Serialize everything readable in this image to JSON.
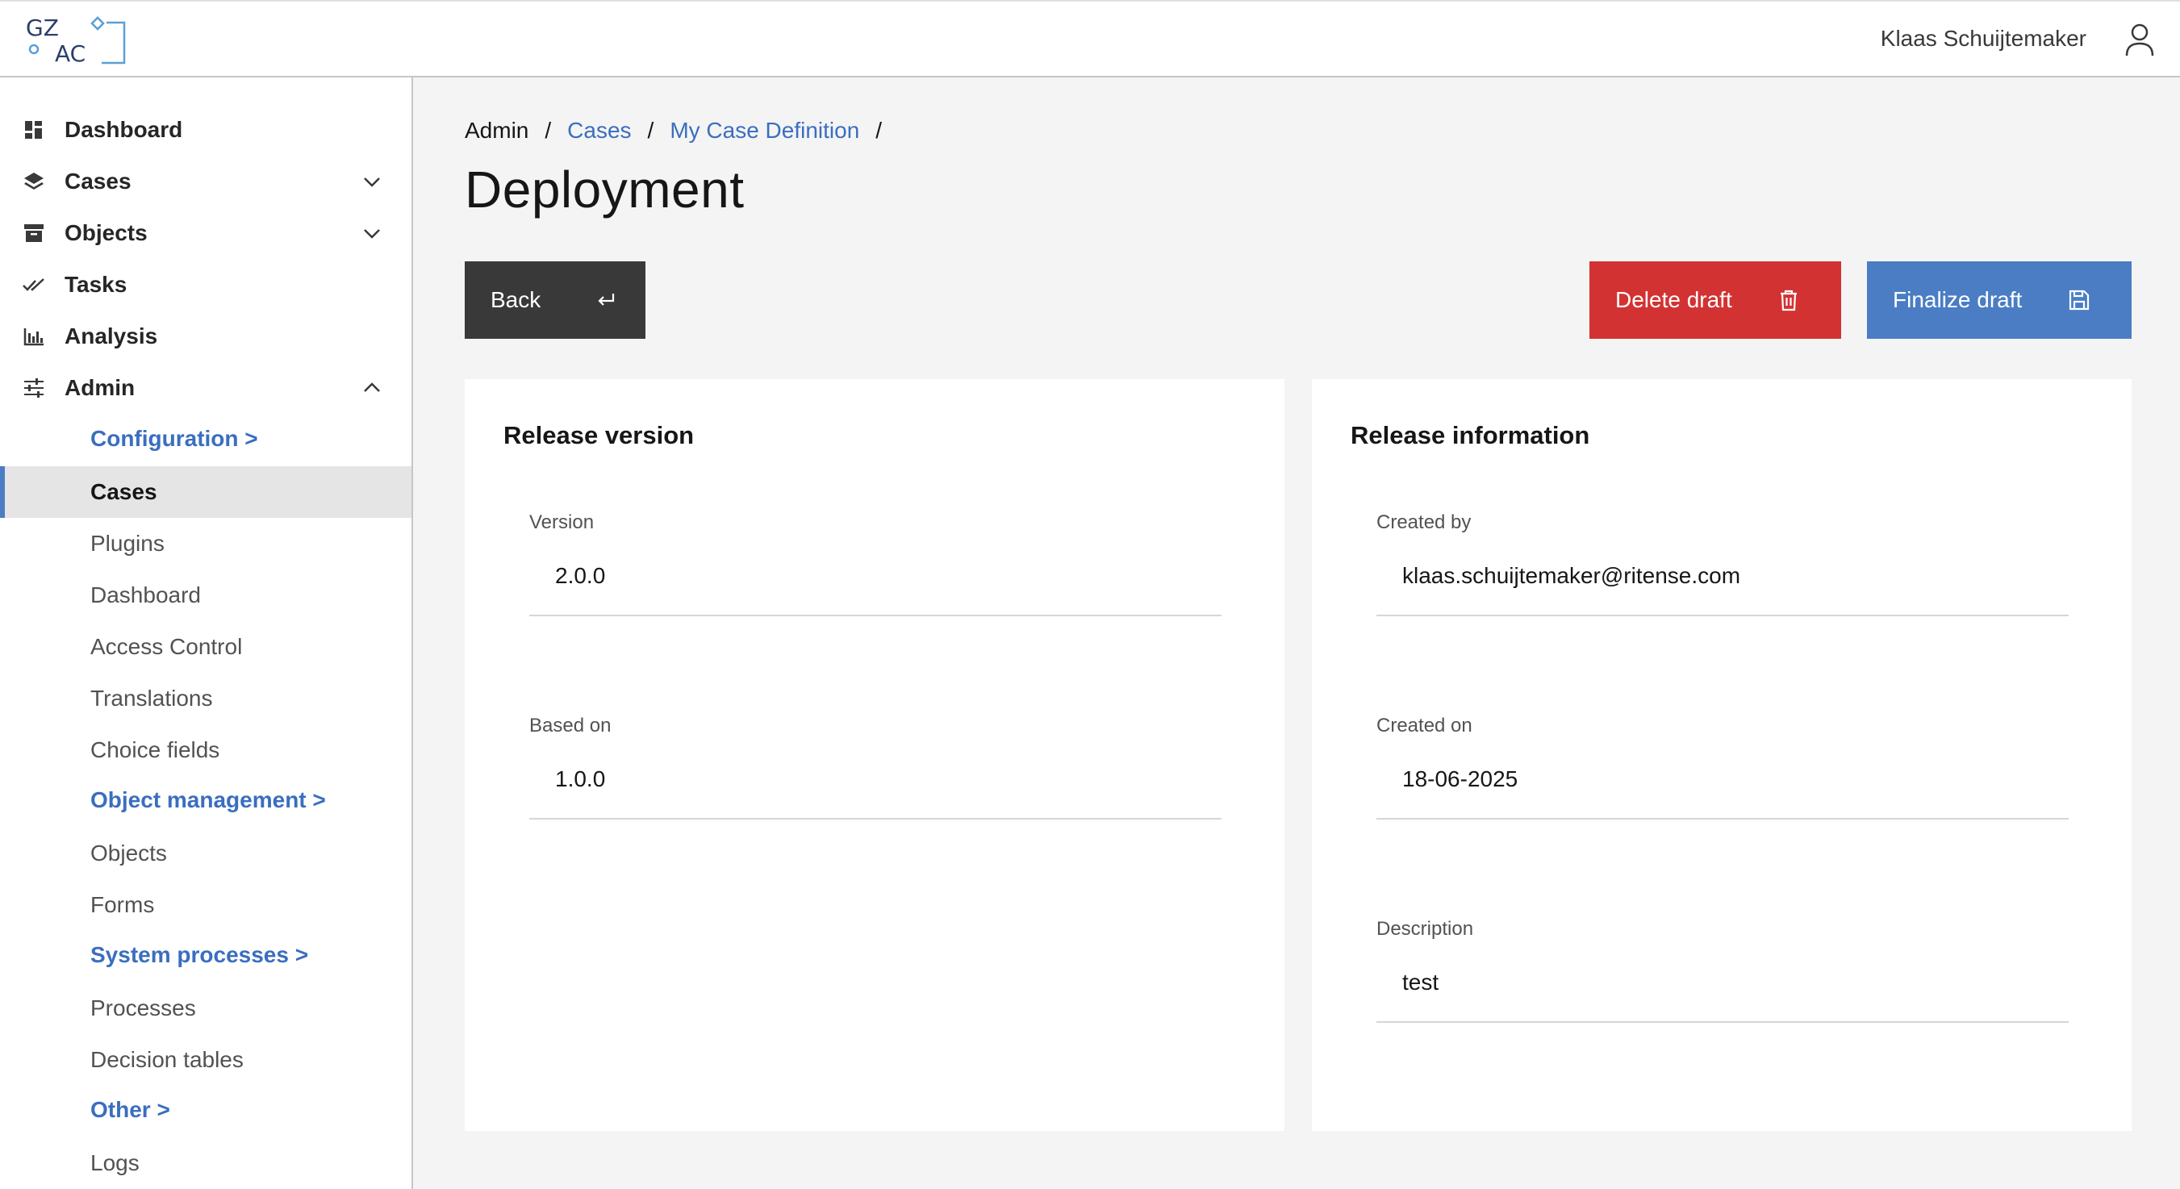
{
  "header": {
    "logo_line1": "GZ",
    "logo_line2": "AC",
    "user_name": "Klaas Schuijtemaker",
    "user_icon": "user-icon"
  },
  "sidebar": {
    "main_items": [
      {
        "label": "Dashboard",
        "icon": "grid-icon"
      },
      {
        "label": "Cases",
        "icon": "layers-icon",
        "chevron": "down"
      },
      {
        "label": "Objects",
        "icon": "archive-icon",
        "chevron": "down"
      },
      {
        "label": "Tasks",
        "icon": "checkmark-icon"
      },
      {
        "label": "Analysis",
        "icon": "bar-chart-icon"
      },
      {
        "label": "Admin",
        "icon": "sliders-icon",
        "chevron": "up"
      }
    ],
    "sub_items": [
      {
        "label": "Configuration >",
        "type": "group"
      },
      {
        "label": "Cases",
        "type": "item",
        "active": true
      },
      {
        "label": "Plugins",
        "type": "item"
      },
      {
        "label": "Dashboard",
        "type": "item"
      },
      {
        "label": "Access Control",
        "type": "item"
      },
      {
        "label": "Translations",
        "type": "item"
      },
      {
        "label": "Choice fields",
        "type": "item"
      },
      {
        "label": "Object management >",
        "type": "group"
      },
      {
        "label": "Objects",
        "type": "item"
      },
      {
        "label": "Forms",
        "type": "item"
      },
      {
        "label": "System processes >",
        "type": "group"
      },
      {
        "label": "Processes",
        "type": "item"
      },
      {
        "label": "Decision tables",
        "type": "item"
      },
      {
        "label": "Other >",
        "type": "group"
      },
      {
        "label": "Logs",
        "type": "item"
      }
    ]
  },
  "breadcrumb": [
    "Admin",
    "Cases",
    "My Case Definition"
  ],
  "breadcrumb_separator": "/",
  "page_title": "Deployment",
  "buttons": {
    "back": "Back",
    "delete": "Delete draft",
    "finalize": "Finalize draft"
  },
  "colors": {
    "accent": "#4a7dc4",
    "danger": "#d33232",
    "dark": "#393939"
  },
  "release_version": {
    "title": "Release version",
    "fields": [
      {
        "label": "Version",
        "value": "2.0.0"
      },
      {
        "label": "Based on",
        "value": "1.0.0"
      }
    ]
  },
  "release_information": {
    "title": "Release information",
    "fields": [
      {
        "label": "Created by",
        "value": "klaas.schuijtemaker@ritense.com"
      },
      {
        "label": "Created on",
        "value": "18-06-2025"
      },
      {
        "label": "Description",
        "value": "test"
      }
    ]
  }
}
